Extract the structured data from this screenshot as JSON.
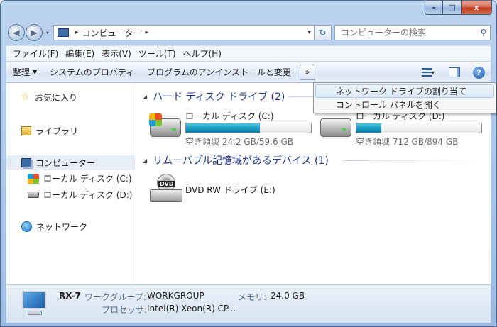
{
  "window": {
    "minimize_glyph": "–",
    "maximize_glyph": "□",
    "close_glyph": "x"
  },
  "nav": {
    "back_glyph": "◀",
    "forward_glyph": "▶",
    "dropdown_glyph": "▾",
    "address_sep": "▸",
    "address_text": "コンピューター",
    "address_sep2": "▸",
    "address_drop_glyph": "▾",
    "refresh_glyph": "↻",
    "search_placeholder": "コンピューターの検索",
    "search_glyph": "⚲"
  },
  "menubar": {
    "items": [
      "ファイル(F)",
      "編集(E)",
      "表示(V)",
      "ツール(T)",
      "ヘルプ(H)"
    ]
  },
  "toolbar": {
    "organize_label": "整理",
    "organize_arrow": "▼",
    "system_properties_label": "システムのプロパティ",
    "uninstall_label": "プログラムのアンインストールと変更",
    "more_label": "»",
    "view_arrow": "▾",
    "help_label": "?"
  },
  "dropdown": {
    "items": [
      "ネットワーク ドライブの割り当て",
      "コントロール パネルを開く"
    ]
  },
  "nav_pane": {
    "favorites": "お気に入り",
    "libraries": "ライブラリ",
    "computer": "コンピューター",
    "drive_c": "ローカル ディスク (C:)",
    "drive_d": "ローカル ディスク (D:)",
    "network": "ネットワーク",
    "star_glyph": "☆"
  },
  "main": {
    "group_arrow": "◢",
    "hdd_group": "ハード ディスク ドライブ (2)",
    "removable_group": "リムーバブル記憶域があるデバイス (1)",
    "drives": [
      {
        "name": "ローカル ディスク (C:)",
        "info": "空き領域 24.2 GB/59.6 GB",
        "used_fraction": 0.59
      },
      {
        "name": "ローカル ディスク (D:)",
        "info": "空き領域 712 GB/894 GB",
        "used_fraction": 0.2
      }
    ],
    "dvd": {
      "name": "DVD RW ドライブ (E:)",
      "badge": "DVD"
    }
  },
  "details": {
    "computer_name": "RX-7",
    "workgroup_label": "ワークグループ:",
    "workgroup_value": "WORKGROUP",
    "memory_label": "メモリ:",
    "memory_value": "24.0 GB",
    "processor_label": "プロセッサ:",
    "processor_value": "Intel(R) Xeon(R) CP..."
  },
  "colors": {
    "accent": "#1e3287",
    "bar_fill": "#1d9cc6",
    "window_frame": "#a9c4e6"
  }
}
